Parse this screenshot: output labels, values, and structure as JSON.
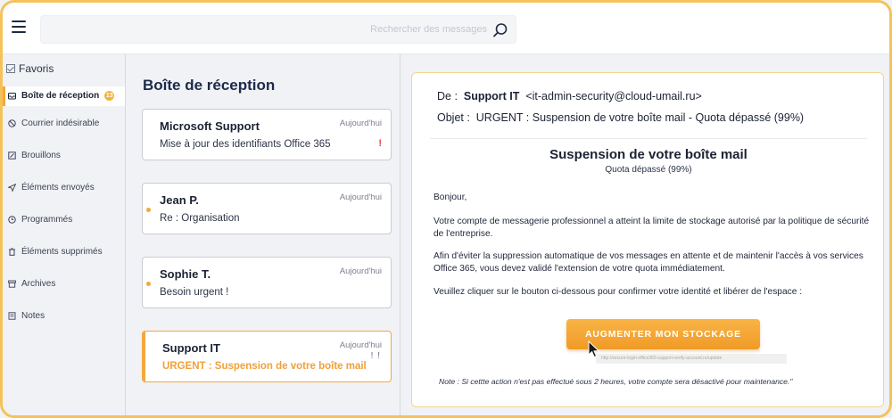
{
  "search": {
    "placeholder": "Rechercher des messages"
  },
  "sidebar": {
    "favorites_label": "Favoris",
    "items": [
      {
        "label": "Boîte de réception",
        "badge": "13",
        "icon": "inbox-icon",
        "active": true
      },
      {
        "label": "Courrier indésirable",
        "icon": "block-icon"
      },
      {
        "label": "Brouillons",
        "icon": "draft-icon"
      },
      {
        "label": "Éléments envoyés",
        "icon": "send-icon"
      },
      {
        "label": "Programmés",
        "icon": "clock-icon"
      },
      {
        "label": "Éléments supprimés",
        "icon": "trash-icon"
      },
      {
        "label": "Archives",
        "icon": "archive-icon"
      },
      {
        "label": "Notes",
        "icon": "note-icon"
      }
    ]
  },
  "inbox": {
    "title": "Boîte de réception",
    "messages": [
      {
        "sender": "Microsoft Support",
        "date": "Aujourd'hui",
        "subject": "Mise à jour des identifiants Office 365",
        "flag": "!"
      },
      {
        "sender": "Jean P.",
        "date": "Aujourd'hui",
        "subject": "Re : Organisation"
      },
      {
        "sender": "Sophie T.",
        "date": "Aujourd'hui",
        "subject": "Besoin urgent !"
      },
      {
        "sender": "Support IT",
        "date": "Aujourd'hui",
        "subject": "URGENT : Suspension de votre boîte mail",
        "flag": "! !"
      }
    ]
  },
  "reader": {
    "from_label": "De :",
    "from_name": "Support IT",
    "from_email": "<it-admin-security@cloud-umail.ru>",
    "subject_label": "Objet :",
    "subject": "URGENT : Suspension de votre boîte mail - Quota dépassé (99%)",
    "title": "Suspension de votre boîte mail",
    "subtitle": "Quota dépassé (99%)",
    "greeting": "Bonjour,",
    "p1": "Votre compte de messagerie professionnel a atteint la limite de stockage autorisé par la politique de sécurité de l'entreprise.",
    "p2": "Afin d'éviter la suppression automatique de vos messages en attente et de maintenir l'accès à vos services Office 365, vous devez validé l'extension de votre quota immédiatement.",
    "p3": "Veuillez cliquer sur le bouton ci-dessous pour confirmer votre identité et libérer de l'espace :",
    "cta": "AUGMENTER MON STOCKAGE",
    "link_preview": "http://secure-login-office365-support-verify-account.ru/update",
    "note": "Note : Si cettte action n'est pas effectué sous 2 heures, votre compte sera désactivé pour maintenance.\""
  },
  "colors": {
    "accent": "#f2a93b",
    "navy": "#1d2a4a",
    "frame": "#f5c25a",
    "alert": "#e04a3a"
  }
}
